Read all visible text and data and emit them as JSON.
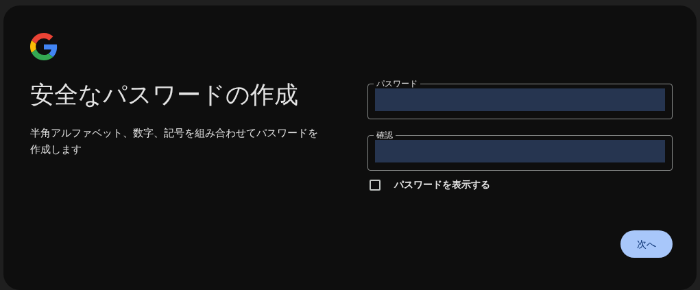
{
  "title": "安全なパスワードの作成",
  "description": "半角アルファベット、数字、記号を組み合わせてパスワードを作成します",
  "fields": [
    {
      "label": "パスワード"
    },
    {
      "label": "確認"
    }
  ],
  "show_password": {
    "label": "パスワードを表示する",
    "checked": false
  },
  "next_button": "次へ"
}
